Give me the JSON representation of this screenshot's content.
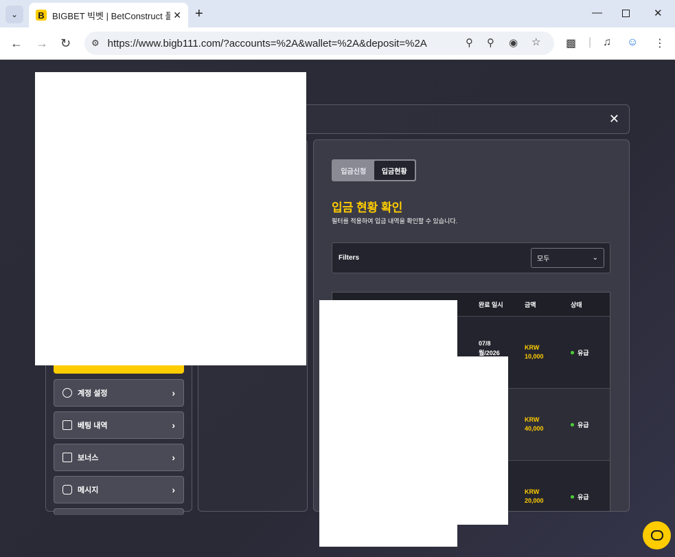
{
  "browser": {
    "tab_title": "BIGBET 빅벳 | BetConstruct 플",
    "favicon_letter": "B",
    "url": "https://www.bigb111.com/?accounts=%2A&wallet=%2A&deposit=%2A",
    "icons": {
      "tab_search": "chevron-down-icon",
      "close": "close-icon",
      "new_tab": "plus-icon",
      "minimize": "minimize-icon",
      "maximize": "maximize-icon",
      "back": "back-arrow-icon",
      "forward": "forward-arrow-icon",
      "reload": "reload-icon",
      "site_info": "site-info-icon",
      "zoom": "zoom-icon",
      "passwords": "key-icon",
      "eye_off": "eye-off-icon",
      "bookmark": "star-icon",
      "extensions": "puzzle-icon",
      "media": "media-queue-icon",
      "profile": "profile-icon",
      "menu": "kebab-menu-icon"
    }
  },
  "sidebar": {
    "items": [
      {
        "label": "계정 설정",
        "icon": "user-circle-icon"
      },
      {
        "label": "베팅 내역",
        "icon": "receipt-icon"
      },
      {
        "label": "보너스",
        "icon": "gift-icon"
      },
      {
        "label": "메시지",
        "icon": "message-icon"
      }
    ]
  },
  "deposit": {
    "tabs": [
      "입금신청",
      "입금현황"
    ],
    "active_tab": "입금현황",
    "title": "입금 현황 확인",
    "subtitle": "필터를 적용하여 입금 내역을 확인할 수 있습니다.",
    "filters_label": "Filters",
    "filter_value": "모두",
    "table": {
      "headers": [
        "완료 일시",
        "금액",
        "상태"
      ],
      "rows": [
        {
          "date_line1": "07/8",
          "date_line2": "월/2026",
          "currency": "KRW",
          "amount": "10,000",
          "status": "유급"
        },
        {
          "date_line1": "",
          "date_line2": "",
          "currency": "KRW",
          "amount": "40,000",
          "status": "유급"
        },
        {
          "date_line1": "",
          "date_line2": "",
          "currency": "KRW",
          "amount": "20,000",
          "status": "유급"
        }
      ]
    }
  },
  "colors": {
    "accent": "#ffcc00",
    "status_ok": "#4cd137",
    "panel_bg": "#3b3b47",
    "table_bg": "#24242e"
  }
}
